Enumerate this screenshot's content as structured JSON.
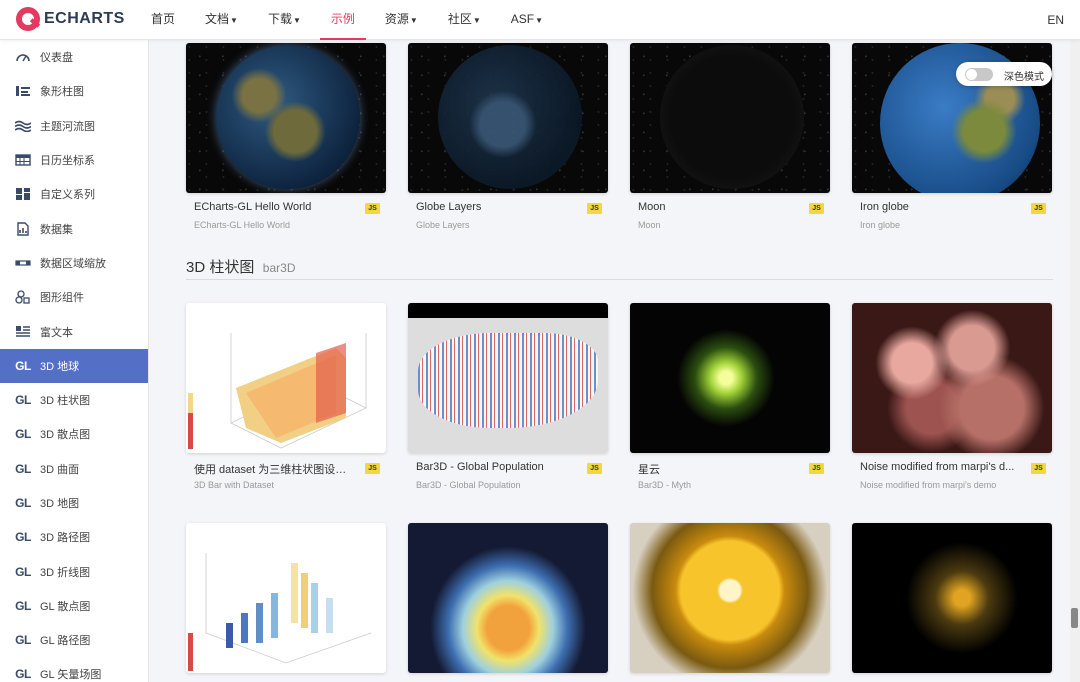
{
  "nav": {
    "logo_text": "ECHARTS",
    "links": [
      {
        "label": "首页",
        "dropdown": false
      },
      {
        "label": "文档",
        "dropdown": true
      },
      {
        "label": "下载",
        "dropdown": true
      },
      {
        "label": "示例",
        "dropdown": false,
        "active": true
      },
      {
        "label": "资源",
        "dropdown": true
      },
      {
        "label": "社区",
        "dropdown": true
      },
      {
        "label": "ASF",
        "dropdown": true
      }
    ],
    "lang": "EN"
  },
  "sidebar": {
    "items": [
      {
        "label": "仪表盘",
        "icon": "gauge-icon"
      },
      {
        "label": "象形柱图",
        "icon": "pictorial-bar-icon"
      },
      {
        "label": "主题河流图",
        "icon": "theme-river-icon"
      },
      {
        "label": "日历坐标系",
        "icon": "calendar-icon"
      },
      {
        "label": "自定义系列",
        "icon": "custom-series-icon"
      },
      {
        "label": "数据集",
        "icon": "dataset-icon"
      },
      {
        "label": "数据区域缩放",
        "icon": "datazoom-icon"
      },
      {
        "label": "图形组件",
        "icon": "graphic-icon"
      },
      {
        "label": "富文本",
        "icon": "rich-text-icon"
      },
      {
        "label": "3D 地球",
        "icon": "gl-icon",
        "active": true
      },
      {
        "label": "3D 柱状图",
        "icon": "gl-icon"
      },
      {
        "label": "3D 散点图",
        "icon": "gl-icon"
      },
      {
        "label": "3D 曲面",
        "icon": "gl-icon"
      },
      {
        "label": "3D 地图",
        "icon": "gl-icon"
      },
      {
        "label": "3D 路径图",
        "icon": "gl-icon"
      },
      {
        "label": "3D 折线图",
        "icon": "gl-icon"
      },
      {
        "label": "GL 散点图",
        "icon": "gl-icon"
      },
      {
        "label": "GL 路径图",
        "icon": "gl-icon"
      },
      {
        "label": "GL 矢量场图",
        "icon": "gl-icon"
      }
    ],
    "gl_text": "GL"
  },
  "dark_mode": {
    "label": "深色模式",
    "enabled": false
  },
  "globe_cards": [
    {
      "title": "ECharts-GL Hello World",
      "subtitle": "ECharts-GL Hello World",
      "badge": "JS"
    },
    {
      "title": "Globe Layers",
      "subtitle": "Globe Layers",
      "badge": "JS"
    },
    {
      "title": "Moon",
      "subtitle": "Moon",
      "badge": "JS"
    },
    {
      "title": "Iron globe",
      "subtitle": "Iron globe",
      "badge": "JS"
    }
  ],
  "section": {
    "title": "3D 柱状图",
    "subtitle": "bar3D"
  },
  "bar3d_cards": [
    {
      "title": "使用 dataset 为三维柱状图设置...",
      "subtitle": "3D Bar with Dataset",
      "badge": "JS"
    },
    {
      "title": "Bar3D - Global Population",
      "subtitle": "Bar3D - Global Population",
      "badge": "JS"
    },
    {
      "title": "星云",
      "subtitle": "Bar3D - Myth",
      "badge": "JS"
    },
    {
      "title": "Noise modified from marpi's d...",
      "subtitle": "Noise modified from marpi's demo",
      "badge": "JS"
    }
  ],
  "colors": {
    "accent": "#e43961",
    "active_sidebar": "#5470c6",
    "badge": "#f1d83c"
  }
}
